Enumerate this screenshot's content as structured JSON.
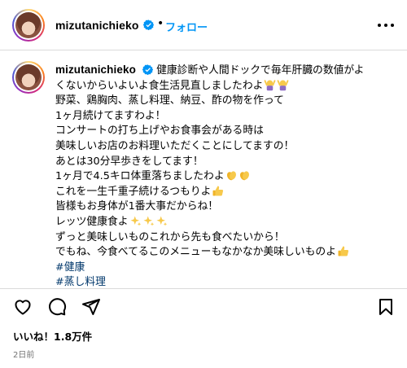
{
  "header": {
    "username": "mizutanichieko",
    "separator": "•",
    "follow_label": "フォロー"
  },
  "caption": {
    "username": "mizutanichieko",
    "lines": [
      "健康診断や人間ドックで毎年肝臓の数値がよ",
      "くないからいよいよ食生活見直しましたわよ",
      "野菜、鶏胸肉、蒸し料理、納豆、酢の物を作って",
      "1ヶ月続けてますわよ！",
      "コンサートの打ち上げやお食事会がある時は",
      "美味しいお店のお料理いただくことにしてますの！",
      "あとは30分早歩きをしてます！",
      "1ヶ月で4.5キロ体重落ちましたわよ",
      "これを一生千重子続けるつもりよ",
      "皆様もお身体が1番大事だからね！",
      "レッツ健康食よ",
      "ずっと美味しいものこれから先も食べたいから！",
      "でもね、今食べてるこのメニューもなかなか美味しいものよ"
    ],
    "hashtags": [
      "#健康",
      "#蒸し料理"
    ],
    "emojis": {
      "raising_hands": "raising-hands-emoji",
      "clapping": "clapping-hands-emoji",
      "thumbs_up": "thumbs-up-emoji",
      "sparkles": "sparkles-emoji"
    }
  },
  "footer": {
    "likes": "いいね！1.8万件",
    "timestamp": "2日前"
  },
  "colors": {
    "link": "#0095f6",
    "hashtag": "#00376b",
    "verified": "#0095f6",
    "divider": "#dbdbdb",
    "muted": "#737373"
  }
}
